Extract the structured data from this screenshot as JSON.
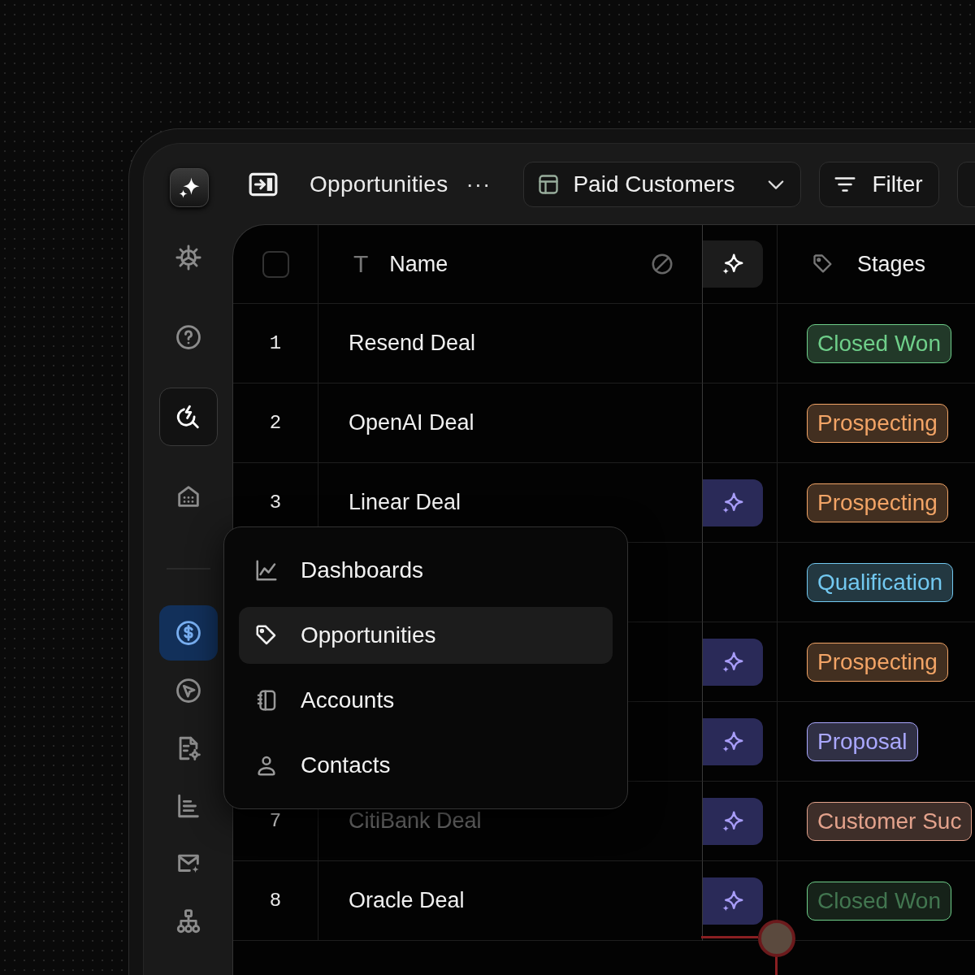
{
  "sidebar": {
    "items": [
      {
        "kind": "gear",
        "selected": false,
        "highlighted": false
      },
      {
        "kind": "help",
        "selected": false,
        "highlighted": false
      },
      {
        "kind": "search-bolt",
        "selected": false,
        "highlighted": true
      },
      {
        "kind": "building",
        "selected": false,
        "highlighted": false
      },
      {
        "kind": "divider"
      },
      {
        "kind": "dollar",
        "selected": true,
        "highlighted": false
      },
      {
        "kind": "cursor",
        "selected": false,
        "highlighted": false
      },
      {
        "kind": "file-gear",
        "selected": false,
        "highlighted": false
      },
      {
        "kind": "bars",
        "selected": false,
        "highlighted": false
      },
      {
        "kind": "mail-sparkle",
        "selected": false,
        "highlighted": false
      },
      {
        "kind": "hierarchy",
        "selected": false,
        "highlighted": false
      }
    ]
  },
  "topbar": {
    "title": "Opportunities",
    "more": "···",
    "view": {
      "label": "Paid Customers"
    },
    "filter": {
      "label": "Filter"
    }
  },
  "table": {
    "columns": [
      {
        "kind": "checkbox",
        "checked": false
      },
      {
        "kind": "text",
        "type_icon": "T",
        "label": "Name"
      },
      {
        "kind": "ai"
      },
      {
        "kind": "tag",
        "label": "Stages"
      }
    ],
    "rows": [
      {
        "number": "1",
        "name": "Resend Deal",
        "faded": false,
        "ai": false,
        "stage": {
          "label": "Closed Won",
          "color": "#6fcf8a",
          "faded": false
        }
      },
      {
        "number": "2",
        "name": "OpenAI Deal",
        "faded": false,
        "ai": false,
        "stage": {
          "label": "Prospecting",
          "color": "#f2a466",
          "faded": false
        }
      },
      {
        "number": "3",
        "name": "Linear Deal",
        "faded": false,
        "ai": true,
        "stage": {
          "label": "Prospecting",
          "color": "#f2a466",
          "faded": false
        }
      },
      {
        "ai": false,
        "stage": {
          "label": "Qualification",
          "color": "#72c8f0",
          "faded": false
        }
      },
      {
        "ai": true,
        "stage": {
          "label": "Prospecting",
          "color": "#f2a466",
          "faded": false
        }
      },
      {
        "ai": true,
        "stage": {
          "label": "Proposal",
          "color": "#aaa8ff",
          "faded": false
        }
      },
      {
        "number": "7",
        "name": "CitiBank Deal",
        "faded": true,
        "ai": true,
        "stage": {
          "label": "Customer Suc",
          "color": "#e3a28c",
          "faded": false
        }
      },
      {
        "number": "8",
        "name": "Oracle Deal",
        "faded": false,
        "ai": true,
        "stage": {
          "label": "Closed Won",
          "color": "#6fcf8a",
          "faded": true
        }
      }
    ]
  },
  "menu": {
    "items": [
      {
        "kind": "chart",
        "label": "Dashboards",
        "selected": false
      },
      {
        "kind": "tag",
        "label": "Opportunities",
        "selected": true
      },
      {
        "kind": "book",
        "label": "Accounts",
        "selected": false
      },
      {
        "kind": "person",
        "label": "Contacts",
        "selected": false
      }
    ]
  }
}
